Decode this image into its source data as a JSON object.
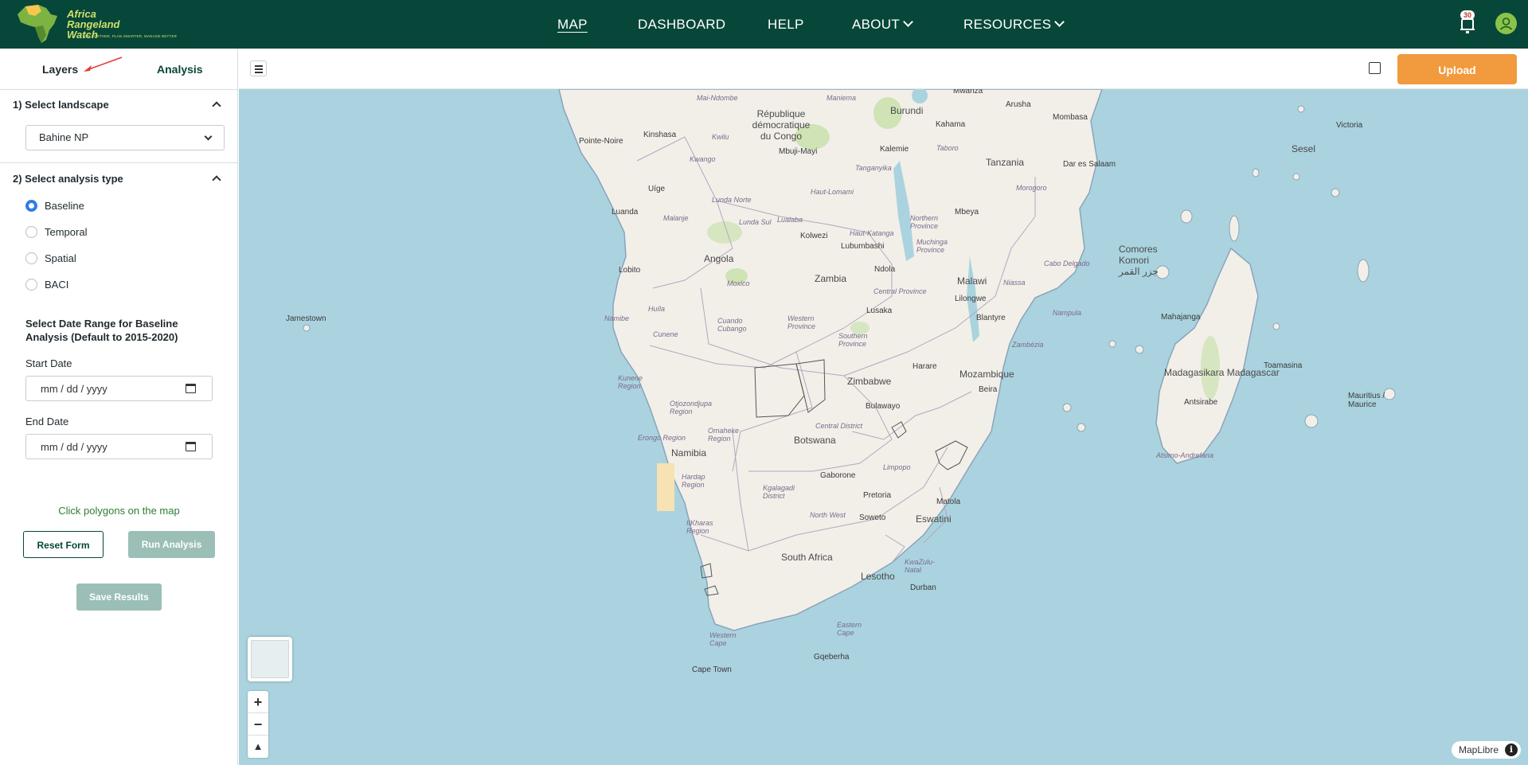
{
  "header": {
    "logo_text": "Africa\nRangeland\nWatch",
    "logo_line1": "Africa",
    "logo_line2": "Rangeland",
    "logo_line3": "Watch",
    "logo_tagline": "SEE FURTHER, PLAN SMARTER, MANAGE BETTER",
    "nav": {
      "map": "MAP",
      "dashboard": "DASHBOARD",
      "help": "HELP",
      "about": "ABOUT",
      "resources": "RESOURCES"
    },
    "notification_count": "30"
  },
  "sidebar": {
    "tabs": {
      "layers": "Layers",
      "analysis": "Analysis"
    },
    "landscape": {
      "heading": "1) Select landscape",
      "selected": "Bahine NP"
    },
    "analysis_type": {
      "heading": "2) Select analysis type",
      "options": [
        "Baseline",
        "Temporal",
        "Spatial",
        "BACI"
      ],
      "selected": "Baseline"
    },
    "date_range": {
      "heading": "Select Date Range for Baseline Analysis (Default to 2015-2020)",
      "start_label": "Start Date",
      "start_placeholder": "mm / dd / yyyy",
      "end_label": "End Date",
      "end_placeholder": "mm / dd / yyyy"
    },
    "hint": "Click polygons on the map",
    "buttons": {
      "reset": "Reset Form",
      "run": "Run Analysis",
      "save": "Save Results"
    }
  },
  "map_toolbar": {
    "upload": "Upload"
  },
  "map": {
    "attribution": "MapLibre",
    "labels": {
      "countries": [
        "Angola",
        "Zambia",
        "Malawi",
        "Tanzania",
        "Mozambique",
        "Zimbabwe",
        "Botswana",
        "Namibia",
        "South Africa",
        "Lesotho",
        "Eswatini",
        "Madagasikara\nMadagascar",
        "Burundi",
        "République\ndémocratique\ndu Congo",
        "Comores\nKomori\nجزر القمر",
        "Sesel",
        "Mauritius /\nMaurice"
      ],
      "cities": [
        "Kinshasa",
        "Pointe-Noire",
        "Luanda",
        "Lobito",
        "Lusaka",
        "Harare",
        "Gaborone",
        "Pretoria",
        "Soweto",
        "Durban",
        "Gqeberha",
        "Cape Town",
        "Dar es Salaam",
        "Mombasa",
        "Victoria",
        "Mahajanga",
        "Toamasina",
        "Antsirabe",
        "Lilongwe",
        "Blantyre",
        "Beira",
        "Matola",
        "Bulawayo",
        "Kolwezi",
        "Lubumbashi",
        "Ndola",
        "Mbeya",
        "Jamestown",
        "Mbuji-Mayi",
        "Kalemie",
        "Kahama",
        "Arusha",
        "Mwanza",
        "Uíge"
      ],
      "regions": [
        "Mai-Ndombe",
        "Maniema",
        "Kwango",
        "Kwilu",
        "Tanganyika",
        "Taboro",
        "Haut-Lomami",
        "Lunda Norte",
        "Lunda Sul",
        "Lualaba",
        "Malanje",
        "Haut-Katanga",
        "Northern\nProvince",
        "Muchinga\nProvince",
        "Moxico",
        "Huíla",
        "Cuando\nCubango",
        "Cunene",
        "Western\nProvince",
        "Southern\nProvince",
        "Central Province",
        "Niassa",
        "Nampula",
        "Zambézia",
        "Cabo Delgado",
        "Morogoro",
        "Namibe",
        "Kunene\nRegion",
        "Otjozondjupa\nRegion",
        "Omaheke\nRegion",
        "Erongo Region",
        "Hardap\nRegion",
        "IIKharas\nRegion",
        "Kgalagadi\nDistrict",
        "Central District",
        "North West",
        "Limpopo",
        "KwaZulu-\nNatal",
        "Eastern\nCape",
        "Western\nCape",
        "Atsimo-Andrefana"
      ]
    }
  }
}
